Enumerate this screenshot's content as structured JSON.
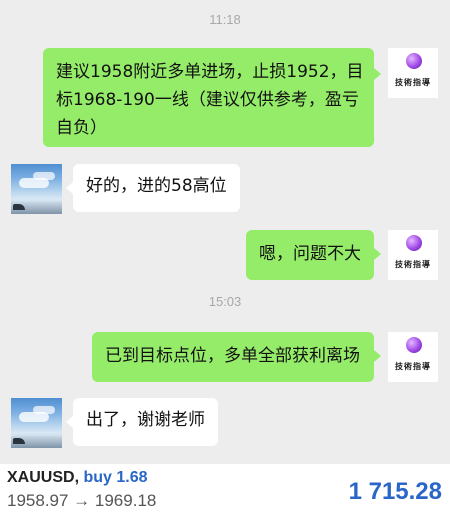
{
  "messages": {
    "time1": "11:18",
    "msg1_text": "建议1958附近多单进场，止损1952，目标1968-190一线（建议仅供参考，盈亏自负）",
    "msg1_line1": "建议1958附近多单进场，止损1952，目",
    "msg1_line2": "标1968-190一线（建议仅供参考，盈亏",
    "msg1_line3": "自负）",
    "msg2_text": "好的，进的58高位",
    "msg3_text": "嗯，问题不大",
    "time2": "15:03",
    "msg4_text": "已到目标点位，多单全部获利离场",
    "msg5_text": "出了，谢谢老师"
  },
  "avatar": {
    "right_logo_text": "技術指導",
    "right_icon": "purple-orb-logo",
    "left_icon": "sky-landscape-photo"
  },
  "trade": {
    "symbol": "XAUUSD",
    "separator": ",",
    "side": "buy 1.68",
    "range": "1958.97 → 1969.18",
    "price": "1 715.28"
  },
  "colors": {
    "green_bubble": "#95ec69",
    "background": "#ededed",
    "accent_blue": "#2a66c8"
  }
}
